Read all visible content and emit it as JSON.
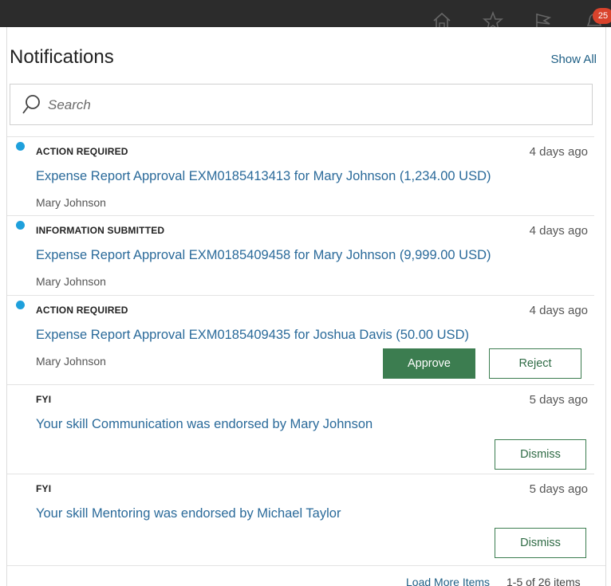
{
  "topbar": {
    "icons": [
      "home-icon",
      "star-icon",
      "flag-icon",
      "bell-icon"
    ],
    "notification_badge": "25",
    "badge_color": "#d9432c"
  },
  "panel": {
    "title": "Notifications",
    "show_all_label": "Show All"
  },
  "search": {
    "placeholder": "Search",
    "value": ""
  },
  "notifications": [
    {
      "unread": true,
      "category": "ACTION REQUIRED",
      "time": "4 days ago",
      "subject": "Expense Report Approval EXM0185413413 for Mary Johnson (1,234.00 USD)",
      "sender": "Mary Johnson"
    },
    {
      "unread": true,
      "category": "INFORMATION SUBMITTED",
      "time": "4 days ago",
      "subject": "Expense Report Approval EXM0185409458 for Mary Johnson (9,999.00 USD)",
      "sender": "Mary Johnson"
    },
    {
      "unread": true,
      "category": "ACTION REQUIRED",
      "time": "4 days ago",
      "subject": "Expense Report Approval EXM0185409435 for Joshua Davis (50.00 USD)",
      "sender": "Mary Johnson",
      "approve_label": "Approve",
      "reject_label": "Reject"
    },
    {
      "unread": false,
      "category": "FYI",
      "time": "5 days ago",
      "subject": "Your skill Communication was endorsed by Mary Johnson",
      "dismiss_label": "Dismiss"
    },
    {
      "unread": false,
      "category": "FYI",
      "time": "5 days ago",
      "subject": "Your skill Mentoring was endorsed by Michael Taylor",
      "dismiss_label": "Dismiss"
    }
  ],
  "footer": {
    "load_more_label": "Load More Items",
    "count_label": "1-5 of 26 items"
  },
  "colors": {
    "accent_link": "#2a6a9a",
    "unread_dot": "#1ea0dc",
    "primary_button": "#3c7d50"
  }
}
